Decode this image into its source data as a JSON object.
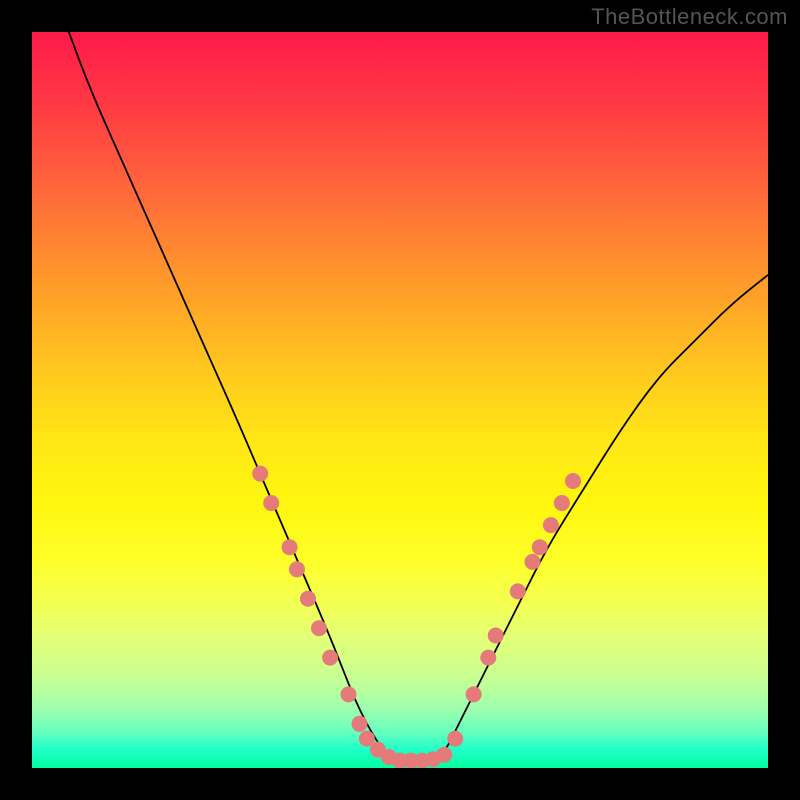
{
  "watermark_text": "TheBottleneck.com",
  "colors": {
    "background": "#000000",
    "curve": "#000000",
    "dots": "#e47a7a"
  },
  "chart_data": {
    "type": "line",
    "title": "",
    "xlabel": "",
    "ylabel": "",
    "xlim": [
      0,
      100
    ],
    "ylim": [
      0,
      100
    ],
    "series": [
      {
        "name": "curve",
        "x": [
          5,
          8,
          12,
          16,
          20,
          24,
          28,
          31,
          34,
          37,
          40,
          42,
          44,
          46,
          48,
          50,
          52,
          54,
          56,
          58,
          62,
          66,
          70,
          75,
          80,
          85,
          90,
          95,
          100
        ],
        "y": [
          100,
          92,
          83,
          74,
          65,
          56,
          47,
          40,
          33,
          26,
          19,
          14,
          9,
          5,
          2,
          0.5,
          0.5,
          0.5,
          2,
          6,
          14,
          22,
          30,
          38,
          46,
          53,
          58,
          63,
          67
        ]
      }
    ],
    "markers": [
      {
        "x": 31,
        "y": 40
      },
      {
        "x": 32.5,
        "y": 36
      },
      {
        "x": 35,
        "y": 30
      },
      {
        "x": 36,
        "y": 27
      },
      {
        "x": 37.5,
        "y": 23
      },
      {
        "x": 39,
        "y": 19
      },
      {
        "x": 40.5,
        "y": 15
      },
      {
        "x": 43,
        "y": 10
      },
      {
        "x": 44.5,
        "y": 6
      },
      {
        "x": 45.5,
        "y": 4
      },
      {
        "x": 47,
        "y": 2.5
      },
      {
        "x": 48.5,
        "y": 1.5
      },
      {
        "x": 50,
        "y": 1
      },
      {
        "x": 51.5,
        "y": 1
      },
      {
        "x": 53,
        "y": 1
      },
      {
        "x": 54.5,
        "y": 1.2
      },
      {
        "x": 56,
        "y": 1.8
      },
      {
        "x": 57.5,
        "y": 4
      },
      {
        "x": 60,
        "y": 10
      },
      {
        "x": 62,
        "y": 15
      },
      {
        "x": 63,
        "y": 18
      },
      {
        "x": 66,
        "y": 24
      },
      {
        "x": 68,
        "y": 28
      },
      {
        "x": 69,
        "y": 30
      },
      {
        "x": 70.5,
        "y": 33
      },
      {
        "x": 72,
        "y": 36
      },
      {
        "x": 73.5,
        "y": 39
      }
    ]
  }
}
